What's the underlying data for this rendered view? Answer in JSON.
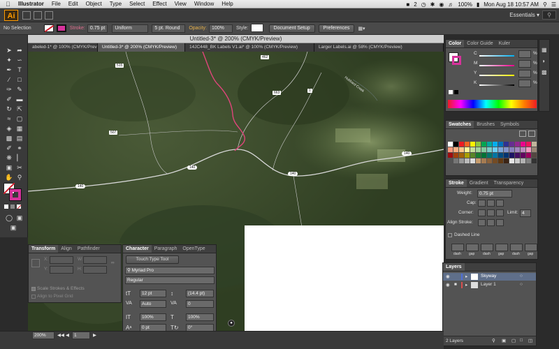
{
  "menubar": {
    "app_name": "Illustrator",
    "menus": [
      "File",
      "Edit",
      "Object",
      "Type",
      "Select",
      "Effect",
      "View",
      "Window",
      "Help"
    ],
    "status": {
      "badge": "2",
      "battery": "100%",
      "datetime": "Mon Aug 18  10:57 AM"
    }
  },
  "appbar": {
    "logo": "Ai",
    "workspace": "Essentials ▾"
  },
  "controlbar": {
    "selection": "No Selection",
    "stroke_label": "Stroke:",
    "stroke_weight": "0.75 pt",
    "profile": "Uniform",
    "brush": "5 pt. Round",
    "opacity_label": "Opacity:",
    "opacity": "100%",
    "style_label": "Style:",
    "doc_setup": "Document Setup",
    "preferences": "Preferences"
  },
  "document": {
    "title": "Untitled-3* @ 200% (CMYK/Preview)",
    "tabs": [
      {
        "label": "abeled-1* @ 100% (CMYK/Preview)",
        "active": false
      },
      {
        "label": "Untitled-3* @ 200% (CMYK/Preview)",
        "active": true
      },
      {
        "label": "14JC448_BK Labels V1.ai* @ 100% (CMYK/Preview)",
        "active": false
      },
      {
        "label": "Larger Labels.ai @ 58% (CMYK/Preview)",
        "active": false
      }
    ]
  },
  "map": {
    "road_labels": [
      "515",
      "462",
      "663",
      "1",
      "507",
      "140",
      "140",
      "140",
      "140"
    ],
    "creek_label": "Hubbard Creek",
    "colors": {
      "route": "#e0457b",
      "road": "#d9d9d9"
    }
  },
  "color_panel": {
    "tabs": [
      "Color",
      "Color Guide",
      "Kuler"
    ],
    "channels": [
      "C",
      "M",
      "Y",
      "K"
    ],
    "unit": "%"
  },
  "swatches_panel": {
    "tabs": [
      "Swatches",
      "Brushes",
      "Symbols"
    ]
  },
  "stroke_panel": {
    "tabs": [
      "Stroke",
      "Gradient",
      "Transparency"
    ],
    "weight_label": "Weight:",
    "weight": "0.75 pt",
    "cap_label": "Cap:",
    "corner_label": "Corner:",
    "limit_label": "Limit:",
    "limit": "4",
    "align_label": "Align Stroke:",
    "dashed_label": "Dashed Line",
    "dash_labels": [
      "dash",
      "gap",
      "dash",
      "gap",
      "dash",
      "gap"
    ]
  },
  "layers_panel": {
    "title": "Layers",
    "layers": [
      {
        "name": "Skyway",
        "selected": true,
        "color": "#4f6fd9"
      },
      {
        "name": "Layer 1",
        "selected": false,
        "color": "#d94f4f"
      }
    ],
    "count": "2 Layers"
  },
  "transform_panel": {
    "tabs": [
      "Transform",
      "Align",
      "Pathfinder"
    ],
    "fields": [
      "X:",
      "W:",
      "Y:",
      "H:"
    ],
    "scale_strokes": "Scale Strokes & Effects",
    "align_pixel": "Align to Pixel Grid"
  },
  "character_panel": {
    "tabs": [
      "Character",
      "Paragraph",
      "OpenType"
    ],
    "touch_tool": "Touch Type Tool",
    "font": "Myriad Pro",
    "style": "Regular",
    "size": "12 pt",
    "leading": "(14.4 pt)",
    "kerning": "Auto",
    "tracking": "0",
    "hscale": "100%",
    "vscale": "100%",
    "baseline": "0 pt",
    "rotation": "0°"
  },
  "statusbar": {
    "zoom": "200%",
    "page": "1"
  }
}
